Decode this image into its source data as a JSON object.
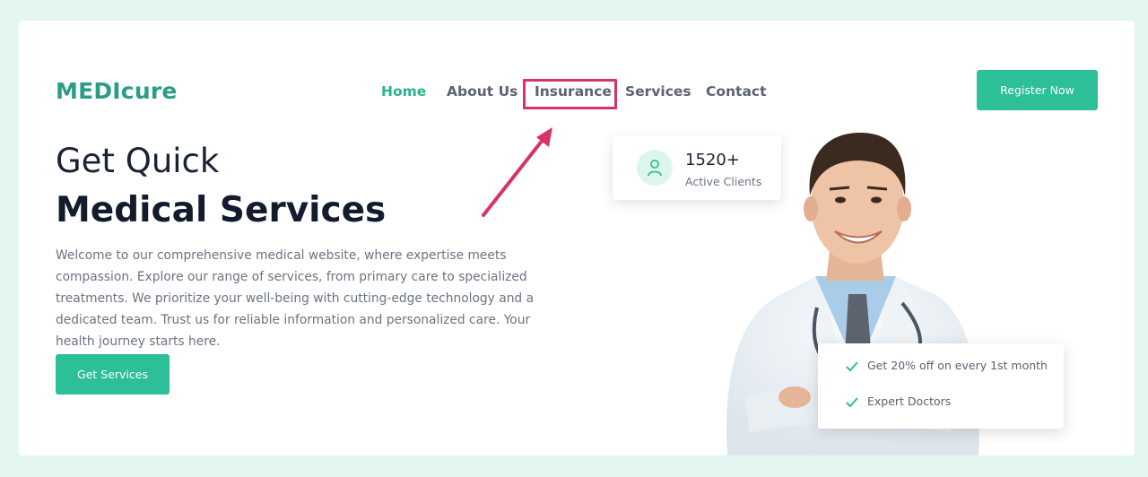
{
  "brand": {
    "logo": "MEDIcure"
  },
  "nav": {
    "items": [
      {
        "label": "Home",
        "active": true
      },
      {
        "label": "About Us",
        "active": false
      },
      {
        "label": "Insurance",
        "active": false,
        "highlighted": true
      },
      {
        "label": "Services",
        "active": false
      },
      {
        "label": "Contact",
        "active": false
      }
    ],
    "register_label": "Register Now"
  },
  "hero": {
    "title_line1": "Get Quick",
    "title_line2": "Medical Services",
    "description": "Welcome to our comprehensive medical website, where expertise meets compassion. Explore our range of services, from primary care to specialized treatments. We prioritize your well-being with cutting-edge technology and a dedicated team. Trust us for reliable information and personalized care. Your health journey starts here.",
    "cta_label": "Get Services"
  },
  "stats": {
    "value": "1520+",
    "label": "Active Clients",
    "icon": "user-icon"
  },
  "features": [
    {
      "text": "Get 20% off on every 1st month",
      "icon": "check-icon"
    },
    {
      "text": "Expert Doctors",
      "icon": "check-icon"
    }
  ],
  "annotation": {
    "color": "#d6336c",
    "target": "Insurance"
  },
  "colors": {
    "accent": "#2cbf98",
    "brand": "#2a9d86",
    "background": "#e3f6f1",
    "heading": "#121c2e"
  }
}
